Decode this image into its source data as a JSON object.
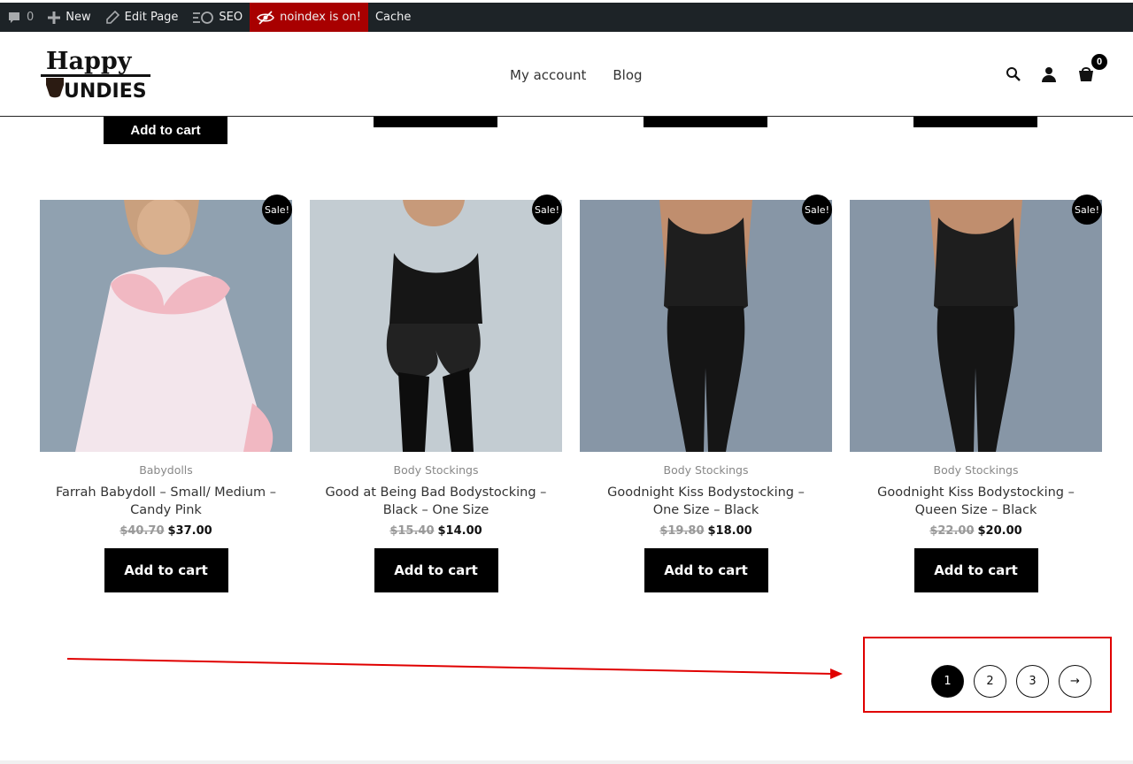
{
  "adminbar": {
    "comments_count": "0",
    "new_label": "New",
    "edit_label": "Edit Page",
    "seo_label": "SEO",
    "noindex_label": "noindex is on!",
    "cache_label": "Cache"
  },
  "header": {
    "logo_line1": "Happy",
    "logo_line2": "UNDIES",
    "nav": [
      "My account",
      "Blog"
    ],
    "cart_count": "0"
  },
  "prev_row": {
    "add_to_cart_label": "Add to cart"
  },
  "products": [
    {
      "category": "Babydolls",
      "title": "Farrah Babydoll – Small/ Medium – Candy Pink",
      "old_price": "$40.70",
      "price": "$37.00",
      "badge": "Sale!",
      "button": "Add to cart"
    },
    {
      "category": "Body Stockings",
      "title": "Good at Being Bad Bodystocking – Black – One Size",
      "old_price": "$15.40",
      "price": "$14.00",
      "badge": "Sale!",
      "button": "Add to cart"
    },
    {
      "category": "Body Stockings",
      "title": "Goodnight Kiss Bodystocking – One Size – Black",
      "old_price": "$19.80",
      "price": "$18.00",
      "badge": "Sale!",
      "button": "Add to cart"
    },
    {
      "category": "Body Stockings",
      "title": "Goodnight Kiss Bodystocking – Queen Size – Black",
      "old_price": "$22.00",
      "price": "$20.00",
      "badge": "Sale!",
      "button": "Add to cart"
    }
  ],
  "pagination": {
    "pages": [
      "1",
      "2",
      "3"
    ],
    "current": "1",
    "next": "→"
  },
  "colors": {
    "adminbar": "#1d2327",
    "noindex": "#a80000",
    "annotation": "#e00000",
    "button": "#000000"
  },
  "icons": [
    "comment-icon",
    "plus-icon",
    "pencil-icon",
    "seo-icon",
    "eye-slash-icon",
    "search-icon",
    "user-icon",
    "cart-icon"
  ]
}
